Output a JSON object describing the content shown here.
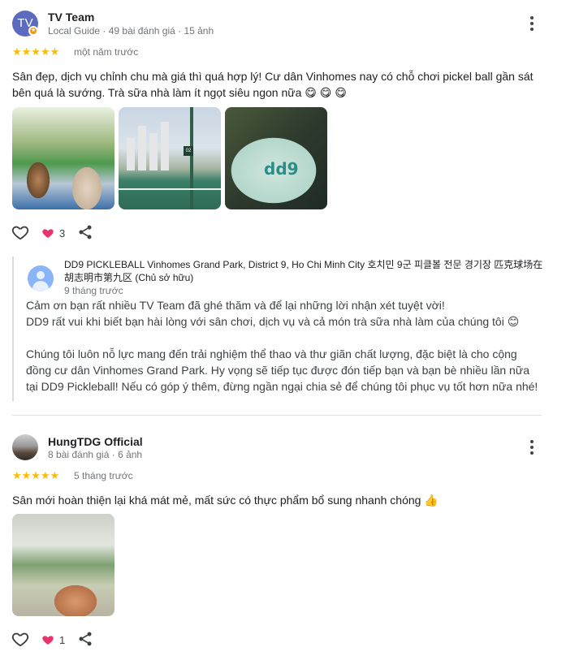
{
  "reviews": [
    {
      "avatar_initials": "TV",
      "name": "TV Team",
      "meta": "Local Guide · 49 bài đánh giá · 15 ảnh",
      "stars": "★★★★★",
      "time": "một năm trước",
      "text_line1": "Sân đẹp, dịch vụ chỉnh chu mà giá thì quá hợp lý! Cư dân Vinhomes nay có chỗ chơi pickel ball gần sát",
      "text_line2": "bên quá là sướng. Trà sữa nhà làm ít ngọt siêu ngon nữa 😋 😋 😋",
      "photo3_logo": "dd9",
      "photo2_sign": "02",
      "love_count": "3",
      "reply": {
        "owner": "DD9 PICKLEBALL Vinhomes Grand Park, District 9, Ho Chi Minh City 호치민 9군 피클볼 전문 경기장 匹克球场在胡志明市第九区 (Chủ sở hữu)",
        "time": "9 tháng trước",
        "para1_line1": "Cảm ơn bạn rất nhiều TV Team đã ghé thăm và để lại những lời nhận xét tuyệt vời!",
        "para1_line2": "DD9 rất vui khi biết bạn hài lòng với sân chơi, dịch vụ và cả món trà sữa nhà làm của chúng tôi 😊",
        "para2_line1": "Chúng tôi luôn nỗ lực mang đến trải nghiệm thể thao và thư giãn chất lượng, đặc biệt là cho cộng",
        "para2_line2": "đồng cư dân Vinhomes Grand Park. Hy vọng sẽ tiếp tục được đón tiếp bạn và bạn bè nhiều lần nữa",
        "para2_line3": "tại DD9 Pickleball! Nếu có góp ý thêm, đừng ngần ngại chia sẻ để chúng tôi phục vụ tốt hơn nữa nhé!"
      }
    },
    {
      "name": "HungTDG Official",
      "meta": "8 bài đánh giá · 6 ảnh",
      "stars": "★★★★★",
      "time": "5 tháng trước",
      "text_line1": "Sân mới hoàn thiện lại khá mát mẻ, mất sức có thực phẩm bổ sung nhanh chóng 👍",
      "love_count": "1"
    }
  ],
  "colors": {
    "star": "#fbbc04",
    "heart": "#e8336d",
    "avatar_tv": "#5c6bc0",
    "local_guide_badge": "#f29900"
  },
  "icons": [
    "more-vert-icon",
    "heart-outline-icon",
    "heart-filled-icon",
    "share-icon",
    "person-icon",
    "local-guide-badge-icon"
  ]
}
